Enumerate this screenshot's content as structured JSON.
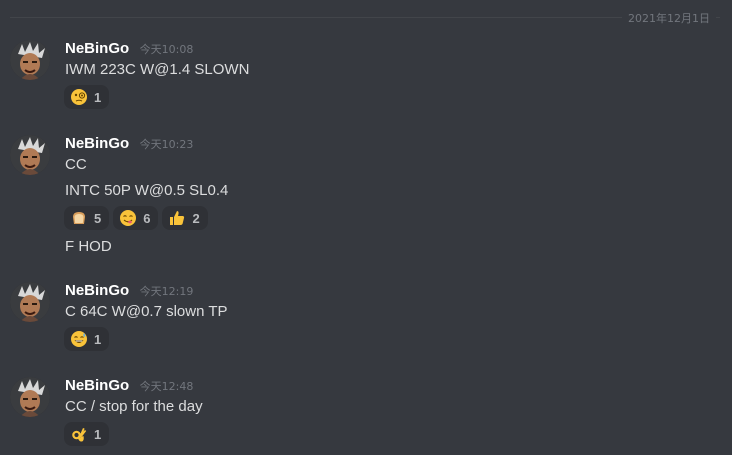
{
  "date_divider": "2021年12月1日",
  "messages": [
    {
      "username": "NeBinGo",
      "timestamp": "今天10:08",
      "lines": [
        "IWM 223C W@1.4 SLOWN"
      ],
      "reactions_a": [
        {
          "emoji": "face-with-monocle-icon",
          "count": "1"
        }
      ]
    },
    {
      "username": "NeBinGo",
      "timestamp": "今天10:23",
      "lines": [
        "CC",
        "INTC 50P W@0.5 SL0.4",
        "F HOD"
      ],
      "reactions_a": [
        {
          "emoji": "bread-icon",
          "count": "5"
        },
        {
          "emoji": "face-savoring-food-icon",
          "count": "6"
        },
        {
          "emoji": "thumbs-up-icon",
          "count": "2"
        }
      ]
    },
    {
      "username": "NeBinGo",
      "timestamp": "今天12:19",
      "lines": [
        "C 64C W@0.7 slown TP"
      ],
      "reactions_a": [
        {
          "emoji": "grinning-sweat-icon",
          "count": "1"
        }
      ]
    },
    {
      "username": "NeBinGo",
      "timestamp": "今天12:48",
      "lines": [
        "CC / stop for the day"
      ],
      "reactions_a": [
        {
          "emoji": "ok-hand-icon",
          "count": "1"
        }
      ]
    }
  ]
}
